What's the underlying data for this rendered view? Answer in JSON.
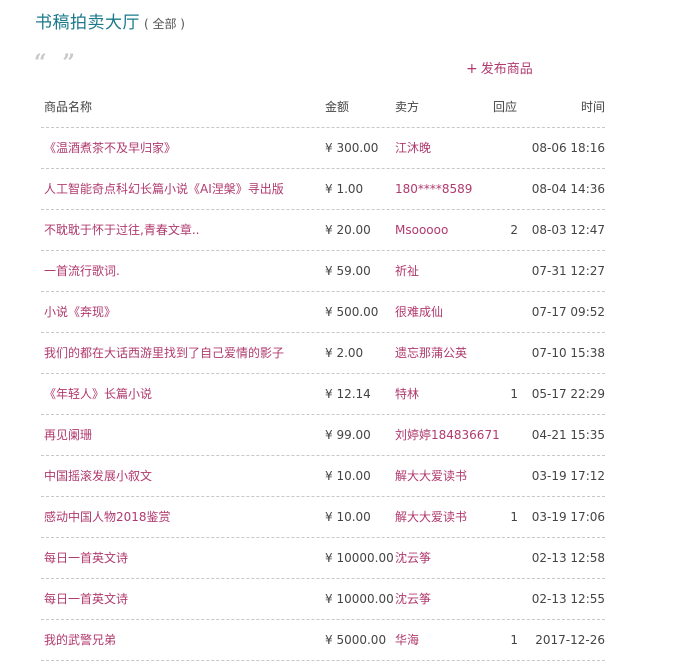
{
  "header": {
    "title": "书稿拍卖大厅",
    "subtitle": "( 全部 )"
  },
  "toolbar": {
    "quote_icon": "quote-icon",
    "publish_label": "发布商品",
    "publish_icon": "+"
  },
  "table": {
    "columns": {
      "name": "商品名称",
      "amount": "金额",
      "seller": "卖方",
      "reply": "回应",
      "time": "时间"
    },
    "rows": [
      {
        "name": "《温酒煮茶不及早归家》",
        "amount": "¥ 300.00",
        "seller": "江沐晚",
        "reply": "",
        "time": "08-06 18:16"
      },
      {
        "name": "人工智能奇点科幻长篇小说《AI涅槃》寻出版",
        "amount": "¥ 1.00",
        "seller": "180****8589",
        "reply": "",
        "time": "08-04 14:36"
      },
      {
        "name": "不耽耽于怀于过往,青春文章..",
        "amount": "¥ 20.00",
        "seller": "Msooooo",
        "reply": "2",
        "time": "08-03 12:47"
      },
      {
        "name": "一首流行歌词.",
        "amount": "¥ 59.00",
        "seller": "祈祉",
        "reply": "",
        "time": "07-31 12:27"
      },
      {
        "name": "小说《奔现》",
        "amount": "¥ 500.00",
        "seller": "很难成仙",
        "reply": "",
        "time": "07-17 09:52"
      },
      {
        "name": "我们的都在大话西游里找到了自己爱情的影子",
        "amount": "¥ 2.00",
        "seller": "遗忘那蒲公英",
        "reply": "",
        "time": "07-10 15:38"
      },
      {
        "name": "《年轻人》长篇小说",
        "amount": "¥ 12.14",
        "seller": "特林",
        "reply": "1",
        "time": "05-17 22:29"
      },
      {
        "name": "再见阑珊",
        "amount": "¥ 99.00",
        "seller": "刘婷婷184836671",
        "reply": "",
        "time": "04-21 15:35"
      },
      {
        "name": "中国摇滚发展小叙文",
        "amount": "¥ 10.00",
        "seller": "解大大爱读书",
        "reply": "",
        "time": "03-19 17:12"
      },
      {
        "name": "感动中国人物2018鉴赏",
        "amount": "¥ 10.00",
        "seller": "解大大爱读书",
        "reply": "1",
        "time": "03-19 17:06"
      },
      {
        "name": "每日一首英文诗",
        "amount": "¥ 10000.00",
        "seller": "沈云筝",
        "reply": "",
        "time": "02-13 12:58"
      },
      {
        "name": "每日一首英文诗",
        "amount": "¥ 10000.00",
        "seller": "沈云筝",
        "reply": "",
        "time": "02-13 12:55"
      },
      {
        "name": "我的武警兄弟",
        "amount": "¥ 5000.00",
        "seller": "华海",
        "reply": "1",
        "time": "2017-12-26"
      }
    ]
  },
  "colors": {
    "title": "#1a7a8c",
    "link": "#b03a6e",
    "text": "#444444",
    "divider": "#c8c8c8"
  }
}
